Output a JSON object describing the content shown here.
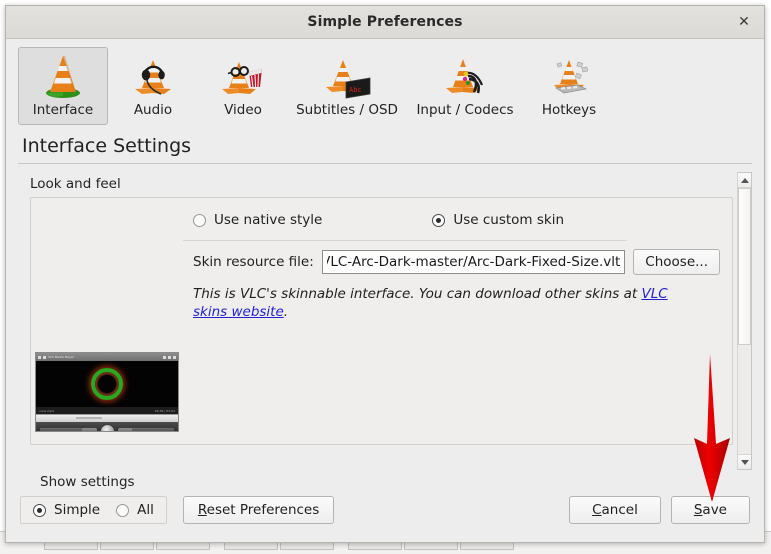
{
  "window": {
    "title": "Simple Preferences",
    "close_label": "✕"
  },
  "toolbar": {
    "items": [
      {
        "label": "Interface",
        "icon": "vlc-cone-icon",
        "selected": true
      },
      {
        "label": "Audio",
        "icon": "vlc-cone-headphones-icon",
        "selected": false
      },
      {
        "label": "Video",
        "icon": "vlc-cone-glasses-icon",
        "selected": false
      },
      {
        "label": "Subtitles / OSD",
        "icon": "vlc-cone-subtitle-icon",
        "selected": false
      },
      {
        "label": "Input / Codecs",
        "icon": "vlc-cone-cables-icon",
        "selected": false
      },
      {
        "label": "Hotkeys",
        "icon": "vlc-cone-keyboard-icon",
        "selected": false
      }
    ]
  },
  "page": {
    "heading": "Interface Settings"
  },
  "look_and_feel": {
    "group_title": "Look and feel",
    "native_style": {
      "label": "Use native style",
      "selected": false
    },
    "custom_skin": {
      "label": "Use custom skin",
      "selected": true
    },
    "skin_file": {
      "label": "Skin resource file:",
      "value": "ls/VLC-Arc-Dark-master/Arc-Dark-Fixed-Size.vlt",
      "choose_label": "Choose..."
    },
    "description": {
      "text_before": "This is VLC's skinnable interface. You can download other skins at ",
      "link_text": "VLC skins website",
      "text_after": "."
    },
    "preview": {
      "window_title": "VLC Media Player",
      "status_left": "cone.mp4",
      "status_right": "00:36 / 01:01"
    }
  },
  "scrollbar": {
    "up_arrow": "scroll-up-arrow",
    "down_arrow": "scroll-down-arrow"
  },
  "bottom": {
    "show_settings_label": "Show settings",
    "simple": {
      "label": "Simple",
      "selected": true
    },
    "all": {
      "label": "All",
      "selected": false
    },
    "reset": {
      "prefix": "R",
      "rest": "eset Preferences"
    },
    "cancel": {
      "prefix": "C",
      "rest": "ancel"
    },
    "save": {
      "prefix": "S",
      "rest": "ave"
    }
  },
  "annotation": {
    "arrow_color": "#e00000",
    "points_to": "save-button"
  }
}
